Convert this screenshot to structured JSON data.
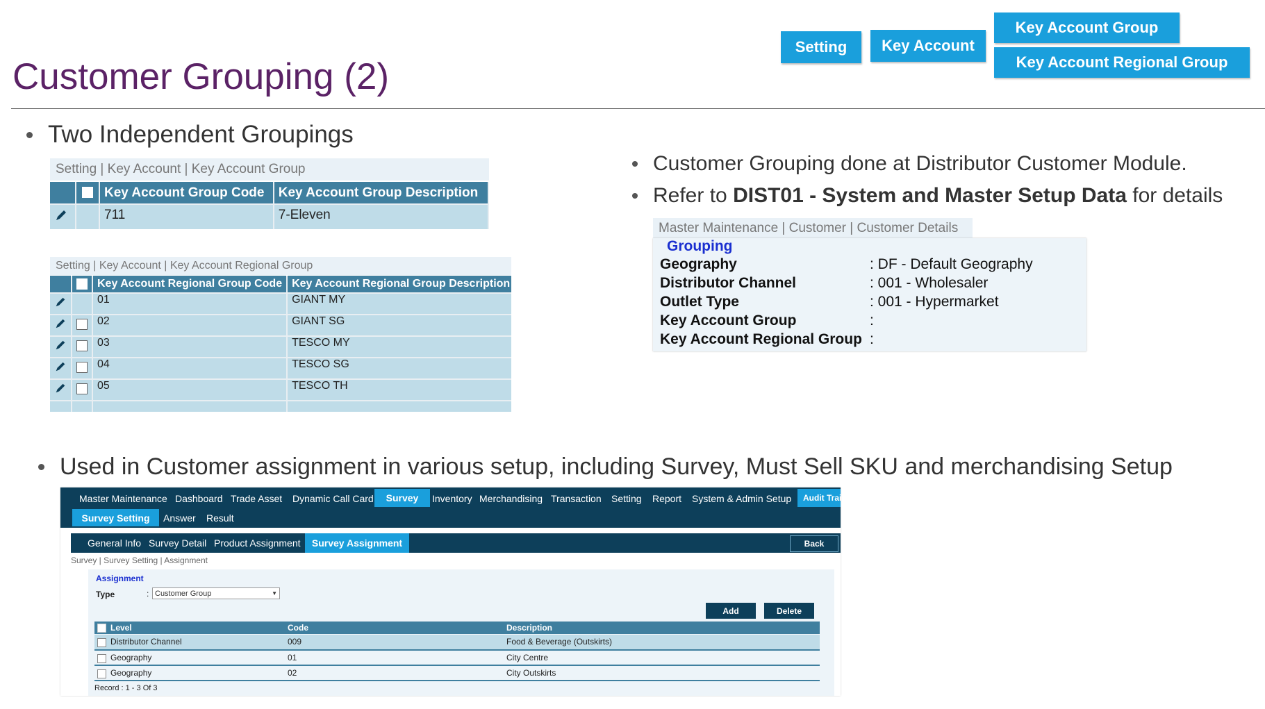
{
  "title": "Customer Grouping (2)",
  "top_buttons": {
    "setting": "Setting",
    "key_account": "Key Account",
    "key_account_group": "Key Account Group",
    "key_account_regional_group": "Key Account Regional Group"
  },
  "bullets": {
    "two_groupings": "Two Independent Groupings",
    "right_1": "Customer Grouping done at Distributor Customer Module.",
    "right_2_pre": "Refer to ",
    "right_2_bold": "DIST01 - System and Master Setup Data",
    "right_2_post": " for details",
    "used_in": "Used in Customer assignment in various setup, including Survey, Must Sell SKU and merchandising Setup"
  },
  "kag_panel": {
    "breadcrumb": "Setting | Key Account | Key Account Group",
    "headers": [
      "Key Account Group Code",
      "Key Account Group Description"
    ],
    "rows": [
      {
        "code": "711",
        "description": "7-Eleven"
      }
    ]
  },
  "karg_panel": {
    "breadcrumb": "Setting | Key Account | Key Account Regional Group",
    "headers": [
      "Key Account Regional Group Code",
      "Key Account Regional Group Description"
    ],
    "rows": [
      {
        "code": "01",
        "description": "GIANT MY"
      },
      {
        "code": "02",
        "description": "GIANT SG"
      },
      {
        "code": "03",
        "description": "TESCO MY"
      },
      {
        "code": "04",
        "description": "TESCO SG"
      },
      {
        "code": "05",
        "description": "TESCO TH"
      }
    ]
  },
  "grouping_panel": {
    "breadcrumb": "Master Maintenance | Customer | Customer Details",
    "section_title": "Grouping",
    "fields": [
      {
        "label": "Geography",
        "value": ": DF - Default Geography"
      },
      {
        "label": "Distributor Channel",
        "value": ": 001 - Wholesaler"
      },
      {
        "label": "Outlet Type",
        "value": ": 001 - Hypermarket"
      },
      {
        "label": "Key Account Group",
        "value": ":"
      },
      {
        "label": "Key Account Regional Group",
        "value": ":"
      }
    ]
  },
  "app": {
    "menu": [
      "Master Maintenance",
      "Dashboard",
      "Trade Asset",
      "Dynamic Call Card",
      "Survey",
      "Inventory",
      "Merchandising",
      "Transaction",
      "Setting",
      "Report",
      "System & Admin Setup",
      "Audit Trai"
    ],
    "selected_menu": "Survey",
    "submenu": [
      "Survey Setting",
      "Answer",
      "Result"
    ],
    "tabs": [
      "General Info",
      "Survey Detail",
      "Product Assignment",
      "Survey Assignment"
    ],
    "back_label": "Back",
    "breadcrumb": "Survey | Survey Setting | Assignment",
    "assignment_title": "Assignment",
    "type_label": "Type",
    "type_colon": ":",
    "type_value": "Customer Group",
    "add_label": "Add",
    "delete_label": "Delete",
    "table_headers": [
      "Level",
      "Code",
      "Description"
    ],
    "rows": [
      {
        "level": "Distributor Channel",
        "code": "009",
        "description": "Food & Beverage (Outskirts)"
      },
      {
        "level": "Geography",
        "code": "01",
        "description": "City Centre"
      },
      {
        "level": "Geography",
        "code": "02",
        "description": "City Outskirts"
      }
    ],
    "record_text": "Record : 1 - 3 Of 3"
  },
  "colors": {
    "title": "#5b2266",
    "top_button": "#1a9fdc",
    "grid_header": "#3f7f9f",
    "grid_row": "#bfdce8",
    "app_nav": "#0d3f5a",
    "grouping_title": "#1a2fd0"
  }
}
